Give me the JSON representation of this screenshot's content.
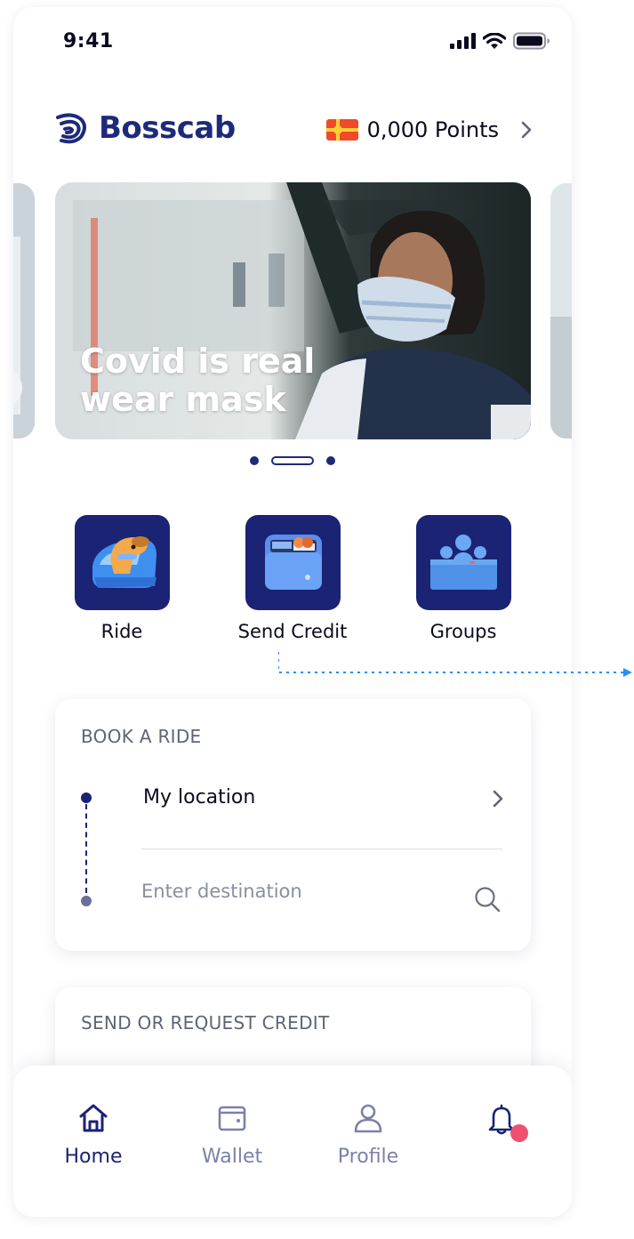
{
  "status_bar": {
    "time": "9:41"
  },
  "header": {
    "brand": "Bosscab",
    "points": "0,000 Points"
  },
  "carousel": {
    "caption_line1": "Covid is real",
    "caption_line2": "wear mask",
    "slide_count": 3,
    "active_slide": 2
  },
  "actions": [
    {
      "label": "Ride",
      "icon": "car-dog-icon"
    },
    {
      "label": "Send Credit",
      "icon": "wallet-icon"
    },
    {
      "label": "Groups",
      "icon": "group-icon"
    }
  ],
  "book_ride": {
    "title": "BOOK A RIDE",
    "pickup": "My location",
    "destination_placeholder": "Enter destination",
    "destination_value": ""
  },
  "credit_card": {
    "title": "SEND OR REQUEST CREDIT"
  },
  "bottom_nav": {
    "items": [
      {
        "label": "Home",
        "icon": "home-icon",
        "active": true
      },
      {
        "label": "Wallet",
        "icon": "wallet-icon",
        "active": false
      },
      {
        "label": "Profile",
        "icon": "profile-icon",
        "active": false
      },
      {
        "label": "",
        "icon": "bell-icon",
        "active": false
      }
    ]
  },
  "colors": {
    "brand_navy": "#1b2374",
    "muted_nav": "#7c80aa",
    "notification": "#f0506e",
    "connector_blue": "#2e8ef0"
  }
}
